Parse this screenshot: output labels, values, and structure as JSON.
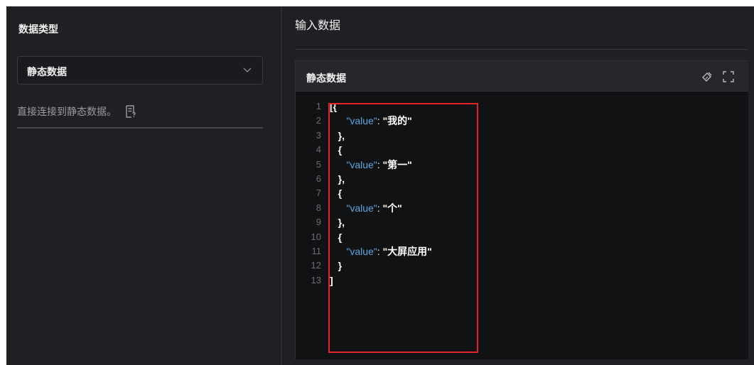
{
  "left_panel": {
    "title": "数据类型",
    "select": {
      "value": "静态数据"
    },
    "description": "直接连接到静态数据。",
    "doc_icon": "document-help-icon",
    "chevron_icon": "chevron-down-icon"
  },
  "right_panel": {
    "title": "输入数据",
    "editor": {
      "title": "静态数据",
      "tools": [
        "format-brush-icon",
        "fullscreen-icon"
      ],
      "line_numbers": [
        "1",
        "2",
        "3",
        "4",
        "5",
        "6",
        "7",
        "8",
        "9",
        "10",
        "11",
        "12",
        "13"
      ],
      "lines": [
        {
          "indent": "",
          "text": "[{"
        },
        {
          "indent": "      ",
          "key": "\"value\"",
          "sep": ": ",
          "val": "\"我的\""
        },
        {
          "indent": "   ",
          "text": "},"
        },
        {
          "indent": "   ",
          "text": "{"
        },
        {
          "indent": "      ",
          "key": "\"value\"",
          "sep": ": ",
          "val": "\"第一\""
        },
        {
          "indent": "   ",
          "text": "},"
        },
        {
          "indent": "   ",
          "text": "{"
        },
        {
          "indent": "      ",
          "key": "\"value\"",
          "sep": ": ",
          "val": "\"个\""
        },
        {
          "indent": "   ",
          "text": "},"
        },
        {
          "indent": "   ",
          "text": "{"
        },
        {
          "indent": "      ",
          "key": "\"value\"",
          "sep": ": ",
          "val": "\"大屏应用\""
        },
        {
          "indent": "   ",
          "text": "}"
        },
        {
          "indent": "",
          "text": "]"
        }
      ]
    }
  },
  "colors": {
    "background": "#1f2023",
    "editor_bg": "#111214",
    "json_key": "#5ea7e0",
    "highlight_border": "#e8202a"
  }
}
